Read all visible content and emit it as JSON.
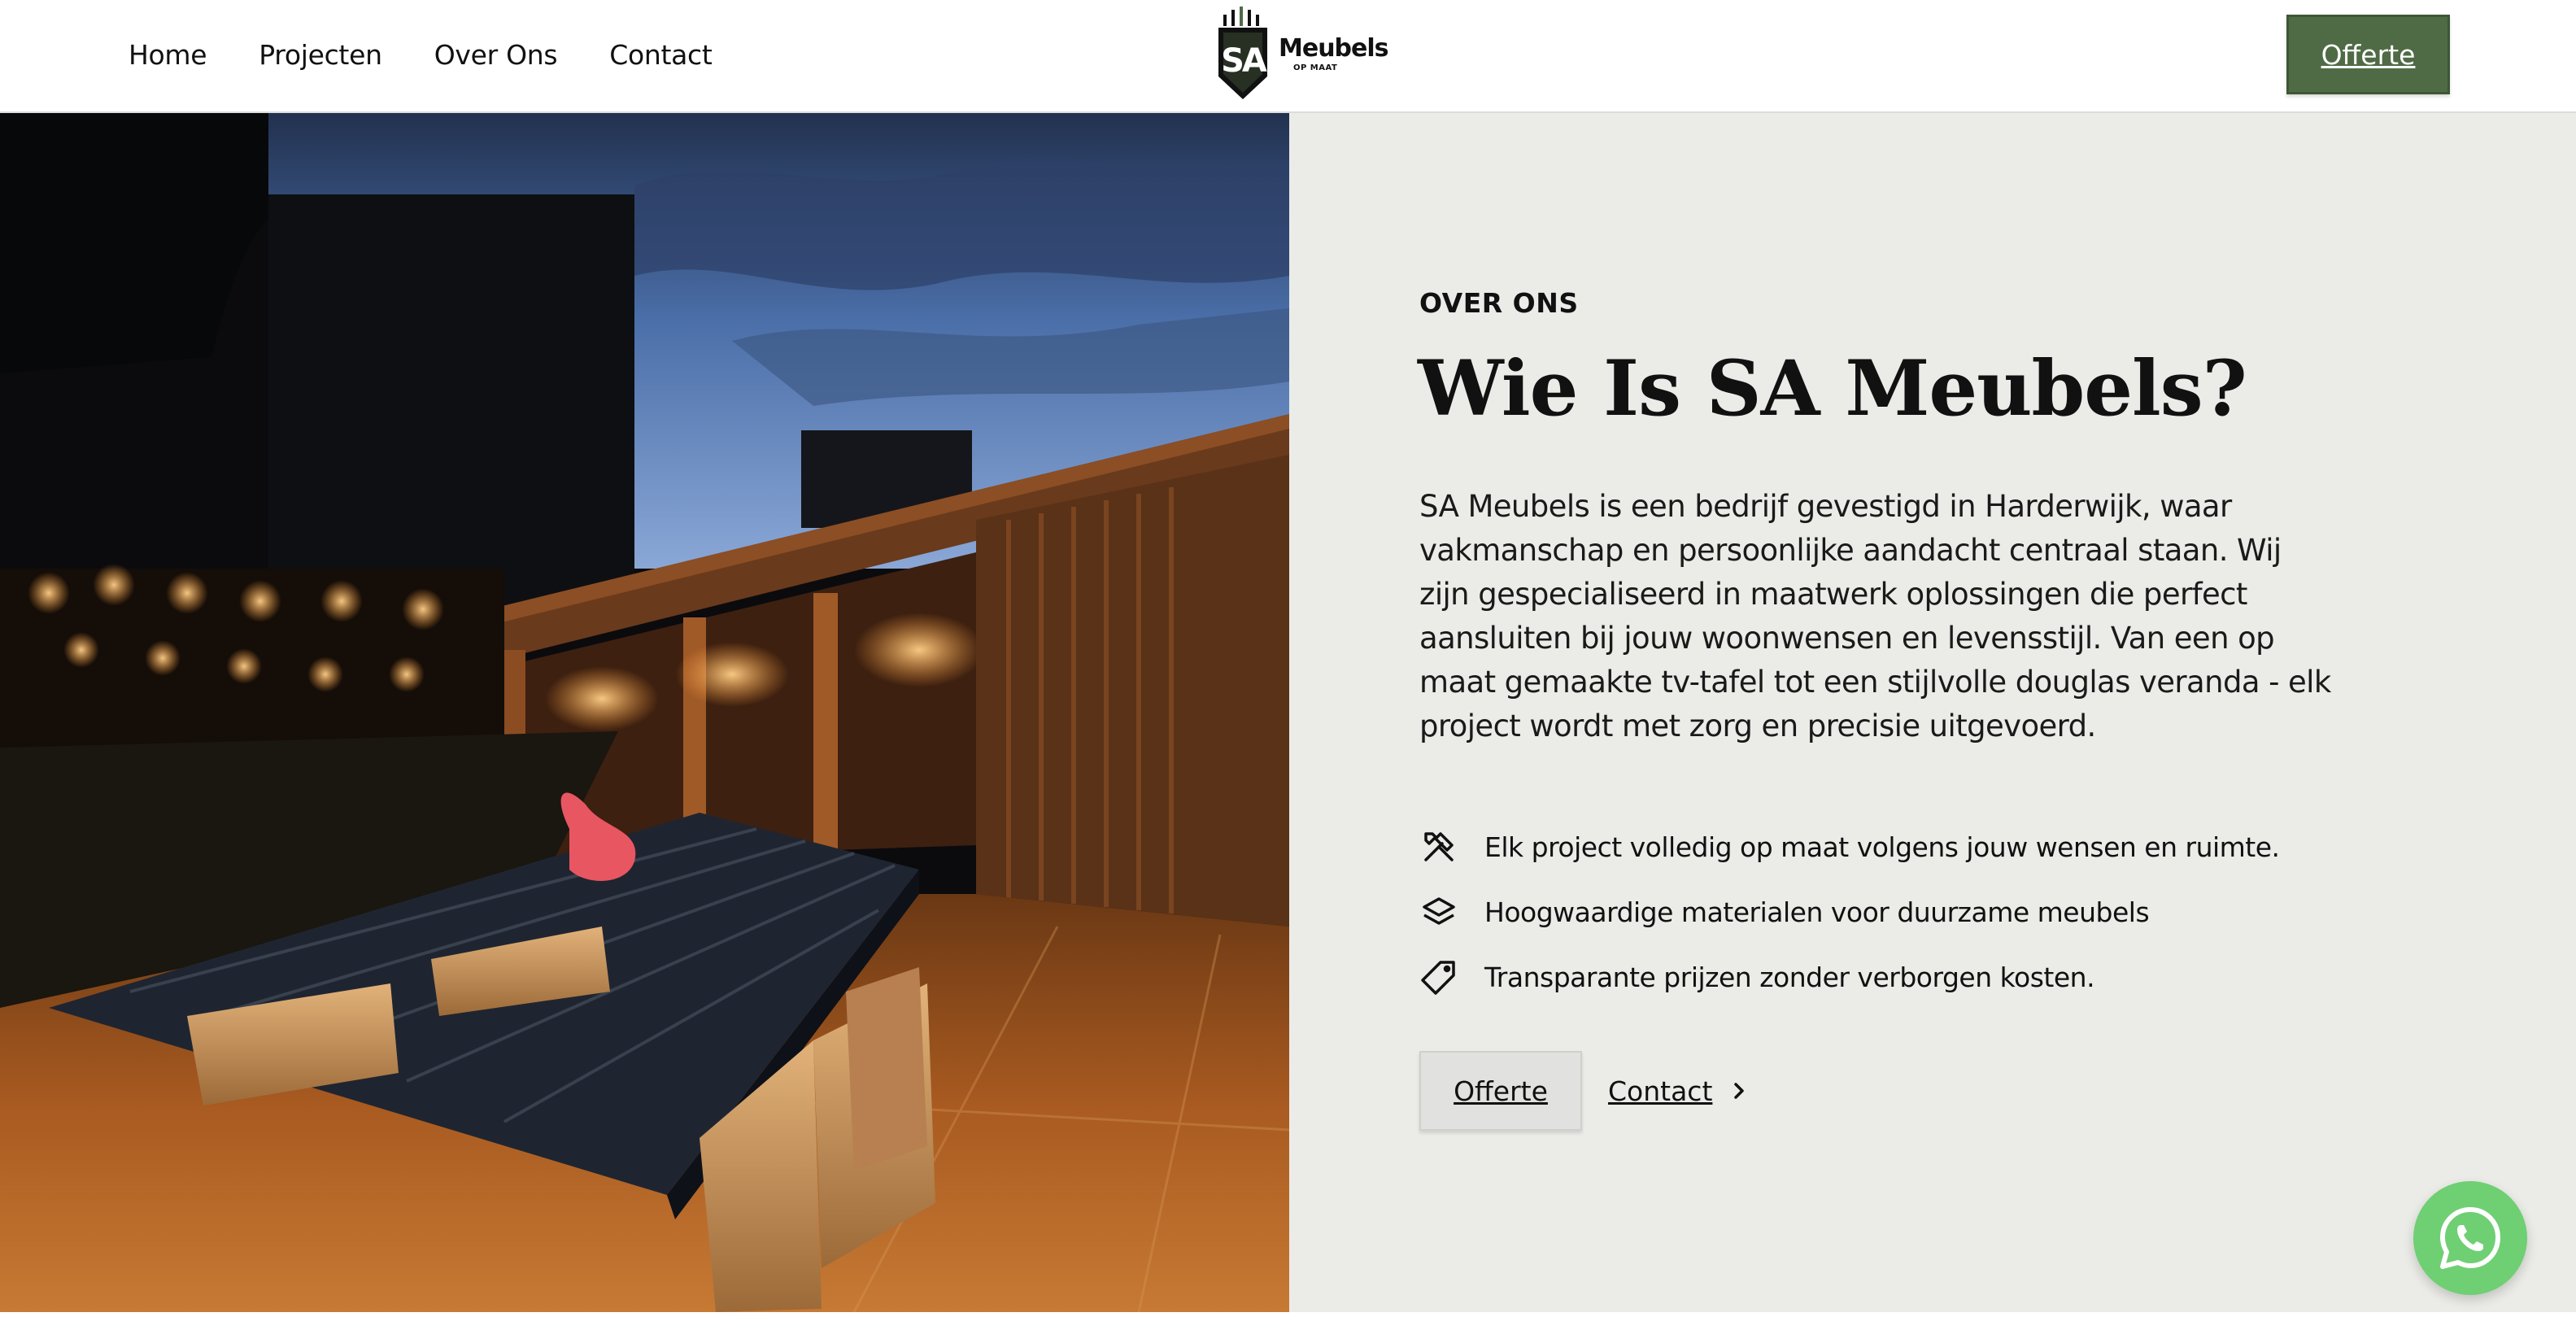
{
  "nav": {
    "items": [
      "Home",
      "Projecten",
      "Over Ons",
      "Contact"
    ],
    "cta_label": "Offerte"
  },
  "logo": {
    "wordmark": "Meubels",
    "tagline": "OP MAAT",
    "monogram": "SA"
  },
  "about": {
    "eyebrow": "OVER ONS",
    "title": "Wie Is SA Meubels?",
    "body": "SA Meubels is een bedrijf gevestigd in Harderwijk, waar vakmanschap en persoonlijke aandacht centraal staan. Wij zijn gespecialiseerd in maatwerk oplossingen die perfect aansluiten bij jouw woonwensen en levensstijl. Van een op maat gemaakte tv-tafel tot een stijlvolle douglas veranda - elk project wordt met zorg en precisie uitgevoerd.",
    "features": [
      {
        "icon": "tools-icon",
        "text": "Elk project volledig op maat volgens jouw wensen en ruimte."
      },
      {
        "icon": "layers-icon",
        "text": "Hoogwaardige materialen voor duurzame meubels"
      },
      {
        "icon": "price-tag-icon",
        "text": "Transparante prijzen zonder verborgen kosten."
      }
    ],
    "buttons": {
      "primary": "Offerte",
      "secondary": "Contact"
    }
  },
  "colors": {
    "brand_green": "#4f6b45",
    "panel_bg": "#ebece8",
    "whatsapp_green": "#6fcf73"
  },
  "photo": {
    "subject": "garden-veranda-evening-photo"
  },
  "floating": {
    "icon": "whatsapp-icon"
  }
}
